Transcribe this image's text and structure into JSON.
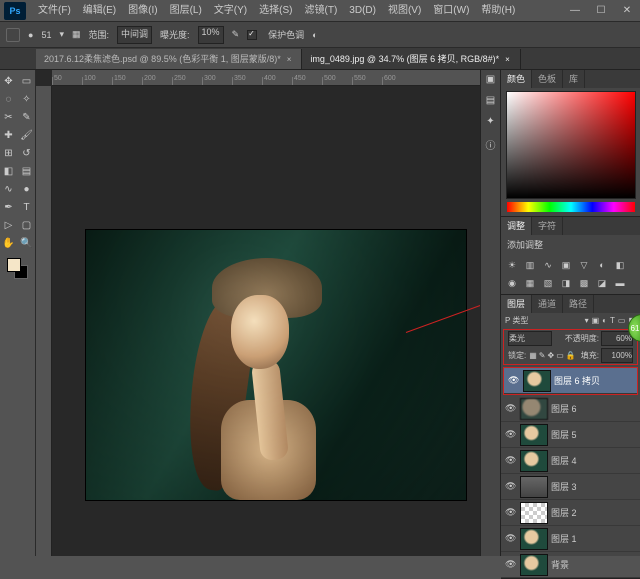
{
  "menu": {
    "items": [
      "文件(F)",
      "编辑(E)",
      "图像(I)",
      "图层(L)",
      "文字(Y)",
      "选择(S)",
      "滤镜(T)",
      "3D(D)",
      "视图(V)",
      "窗口(W)",
      "帮助(H)"
    ]
  },
  "window_controls": {
    "min": "—",
    "max": "☐",
    "close": "✕"
  },
  "options": {
    "range_label": "范围:",
    "range_value": "中间调",
    "exposure_label": "曝光度:",
    "exposure_value": "10%",
    "protect": "保护色调",
    "brush_hint": "▾"
  },
  "tabs": [
    {
      "title": "2017.6.12柔焦滤色.psd @ 89.5% (色彩平衡 1, 图层蒙版/8)*",
      "active": false
    },
    {
      "title": "img_0489.jpg @ 34.7% (图层 6 拷贝, RGB/8#)*",
      "active": true
    }
  ],
  "ruler_marks": [
    "50",
    "100",
    "150",
    "200",
    "250",
    "300",
    "350",
    "400",
    "450",
    "500",
    "550",
    "600"
  ],
  "panel_tabs": {
    "color": [
      "颜色",
      "色板",
      "库"
    ],
    "adjust": [
      "调整",
      "字符"
    ],
    "adjust_label": "添加调整",
    "layers": [
      "图层",
      "通道",
      "路径"
    ]
  },
  "layer_opts": {
    "kind_label": "P 类型",
    "blend": "柔光",
    "opacity_label": "不透明度:",
    "opacity": "60%",
    "lock_label": "锁定:",
    "fill_label": "填充:",
    "fill": "100%"
  },
  "layers": [
    {
      "name": "图层 6 拷贝",
      "sel": true,
      "thumb": "t-img"
    },
    {
      "name": "图层 6",
      "thumb": "t-blur"
    },
    {
      "name": "图层 5",
      "thumb": "t-img"
    },
    {
      "name": "图层 4",
      "thumb": "t-img"
    },
    {
      "name": "图层 3",
      "thumb": "t-gray"
    },
    {
      "name": "图层 2",
      "thumb": "t-check"
    },
    {
      "name": "图层 1",
      "thumb": "t-img"
    },
    {
      "name": "背景",
      "thumb": "t-img"
    }
  ],
  "green_btn": "61"
}
